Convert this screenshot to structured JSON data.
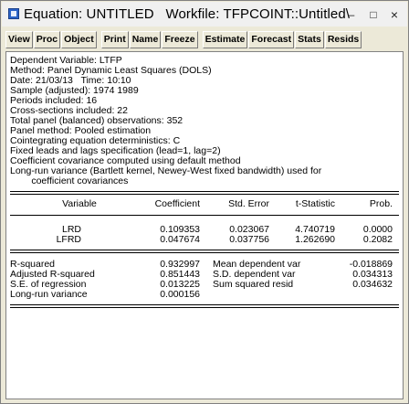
{
  "window": {
    "title": "Equation: UNTITLED   Workfile: TFPCOINT::Untitled\\",
    "controls": {
      "minimize": "–",
      "maximize": "□",
      "close": "×"
    }
  },
  "toolbar": [
    "View",
    "Proc",
    "Object",
    "Print",
    "Name",
    "Freeze",
    "Estimate",
    "Forecast",
    "Stats",
    "Resids"
  ],
  "header_lines": [
    "Dependent Variable: LTFP",
    "Method: Panel Dynamic Least Squares (DOLS)",
    "Date: 21/03/13   Time: 10:10",
    "Sample (adjusted): 1974 1989",
    "Periods included: 16",
    "Cross-sections included: 22",
    "Total panel (balanced) observations: 352",
    "Panel method: Pooled estimation",
    "Cointegrating equation deterministics: C",
    "Fixed leads and lags specification (lead=1, lag=2)",
    "Coefficient covariance computed using default method",
    "Long-run variance (Bartlett kernel, Newey-West fixed bandwidth) used for",
    "        coefficient covariances"
  ],
  "coef_table": {
    "headers": [
      "Variable",
      "Coefficient",
      "Std. Error",
      "t-Statistic",
      "Prob."
    ],
    "rows": [
      [
        "LRD",
        "0.109353",
        "0.023067",
        "4.740719",
        "0.0000"
      ],
      [
        "LFRD",
        "0.047674",
        "0.037756",
        "1.262690",
        "0.2082"
      ]
    ]
  },
  "stats": [
    [
      "R-squared",
      "0.932997",
      "Mean dependent var",
      "-0.018869"
    ],
    [
      "Adjusted R-squared",
      "0.851443",
      "S.D. dependent var",
      "0.034313"
    ],
    [
      "S.E. of regression",
      "0.013225",
      "Sum squared resid",
      "0.034632"
    ],
    [
      "Long-run variance",
      "0.000156",
      "",
      ""
    ]
  ]
}
